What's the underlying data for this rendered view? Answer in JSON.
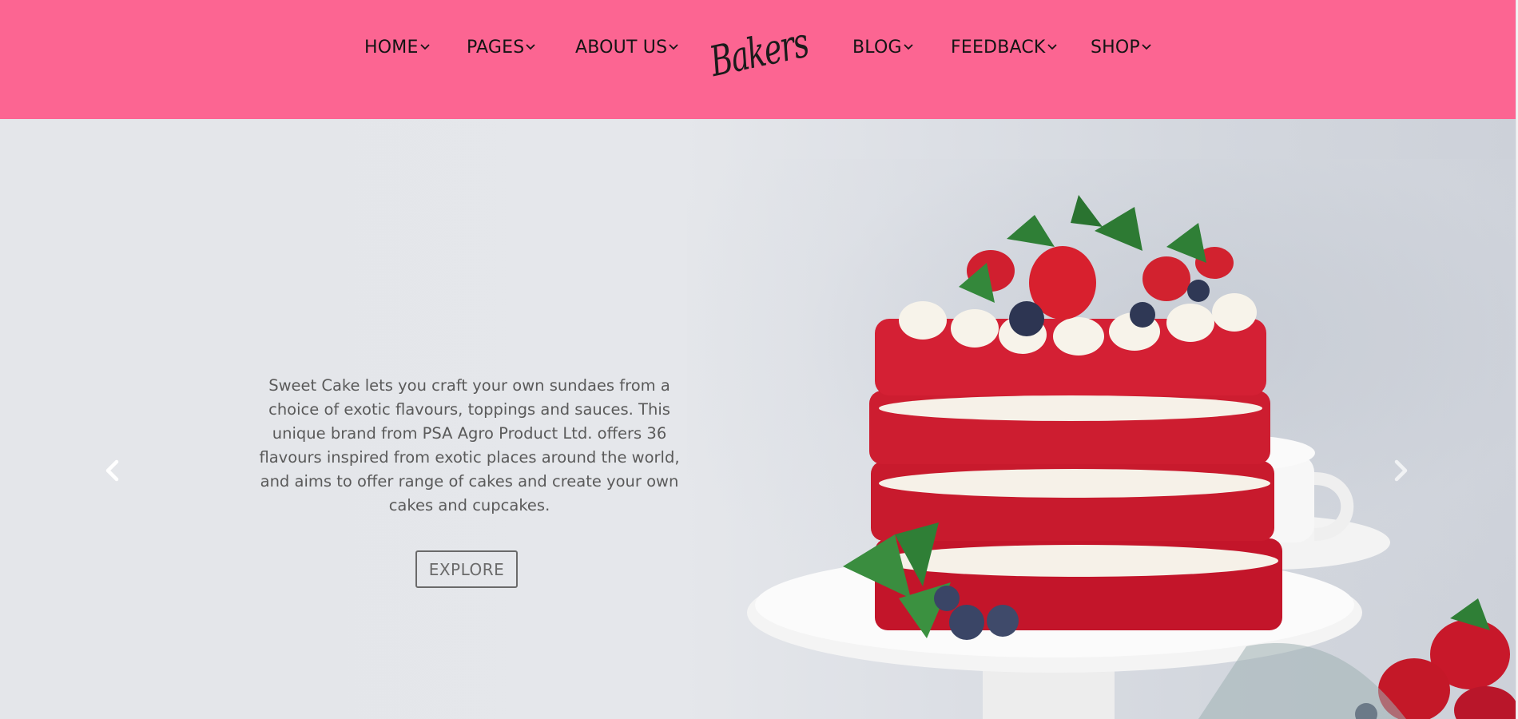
{
  "brand": {
    "logo_text": "Bakers",
    "nav_color": "#fc6592"
  },
  "nav": {
    "left_items": [
      {
        "label": "HOME",
        "icon": "chevron-down-icon"
      },
      {
        "label": "PAGES",
        "icon": "chevron-down-icon"
      },
      {
        "label": "ABOUT US",
        "icon": "chevron-down-icon"
      }
    ],
    "right_items": [
      {
        "label": "BLOG",
        "icon": "chevron-down-icon"
      },
      {
        "label": "FEEDBACK",
        "icon": "chevron-down-icon"
      },
      {
        "label": "SHOP",
        "icon": "chevron-down-icon"
      }
    ]
  },
  "hero": {
    "description": "Sweet Cake lets you craft your own sundaes from a choice of exotic flavours, toppings and sauces. This unique brand from PSA Agro Product Ltd. offers 36 flavours inspired from exotic places around the world, and aims to offer range of cakes and create your own cakes and cupcakes.",
    "button_label": "EXPLORE",
    "prev_icon": "chevron-left-icon",
    "next_icon": "chevron-right-icon",
    "image_subject": "red velvet layer cake with cream, strawberries, blueberries and mint"
  }
}
